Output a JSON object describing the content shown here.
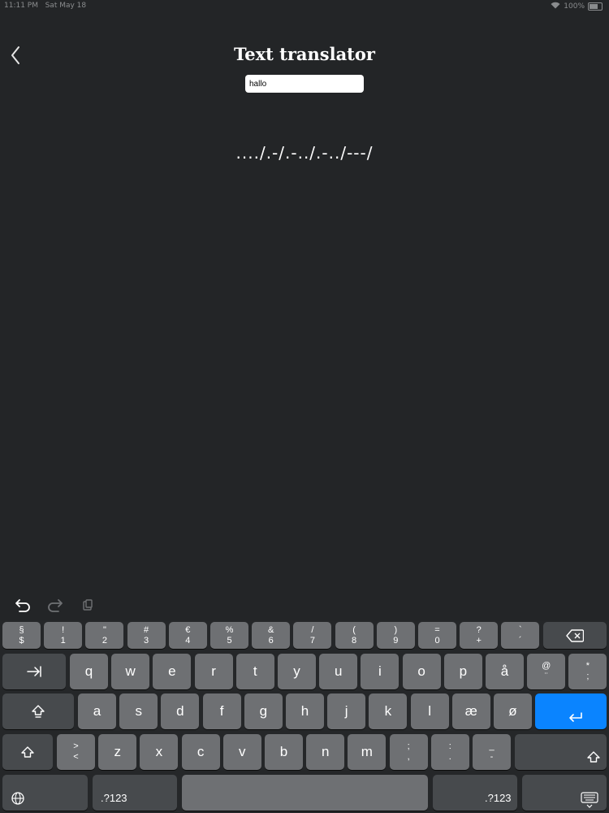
{
  "status_bar": {
    "time": "11:11 PM",
    "date": "Sat May 18",
    "battery": "100%"
  },
  "header": {
    "title": "Text translator"
  },
  "input": {
    "value": "hallo",
    "placeholder": ""
  },
  "output": {
    "morse": "..../.-/.-../.-../---/"
  },
  "keyboard": {
    "row1": [
      {
        "top": "§",
        "bottom": "$"
      },
      {
        "top": "!",
        "bottom": "1"
      },
      {
        "top": "\"",
        "bottom": "2"
      },
      {
        "top": "#",
        "bottom": "3"
      },
      {
        "top": "€",
        "bottom": "4"
      },
      {
        "top": "%",
        "bottom": "5"
      },
      {
        "top": "&",
        "bottom": "6"
      },
      {
        "top": "/",
        "bottom": "7"
      },
      {
        "top": "(",
        "bottom": "8"
      },
      {
        "top": ")",
        "bottom": "9"
      },
      {
        "top": "=",
        "bottom": "0"
      },
      {
        "top": "?",
        "bottom": "+"
      },
      {
        "top": "`",
        "bottom": "´"
      }
    ],
    "row2": [
      "q",
      "w",
      "e",
      "r",
      "t",
      "y",
      "u",
      "i",
      "o",
      "p",
      "å"
    ],
    "row2_extra": [
      {
        "top": "@",
        "bottom": "¨"
      },
      {
        "top": "*",
        "bottom": ";"
      }
    ],
    "row3": [
      "a",
      "s",
      "d",
      "f",
      "g",
      "h",
      "j",
      "k",
      "l",
      "æ",
      "ø"
    ],
    "row4_first": {
      "top": ">",
      "bottom": "<"
    },
    "row4": [
      "z",
      "x",
      "c",
      "v",
      "b",
      "n",
      "m"
    ],
    "row4_extra": [
      {
        "top": ";",
        "bottom": ","
      },
      {
        "top": ":",
        "bottom": "."
      },
      {
        "top": "_",
        "bottom": "-"
      }
    ],
    "numbers_label": ".?123"
  }
}
